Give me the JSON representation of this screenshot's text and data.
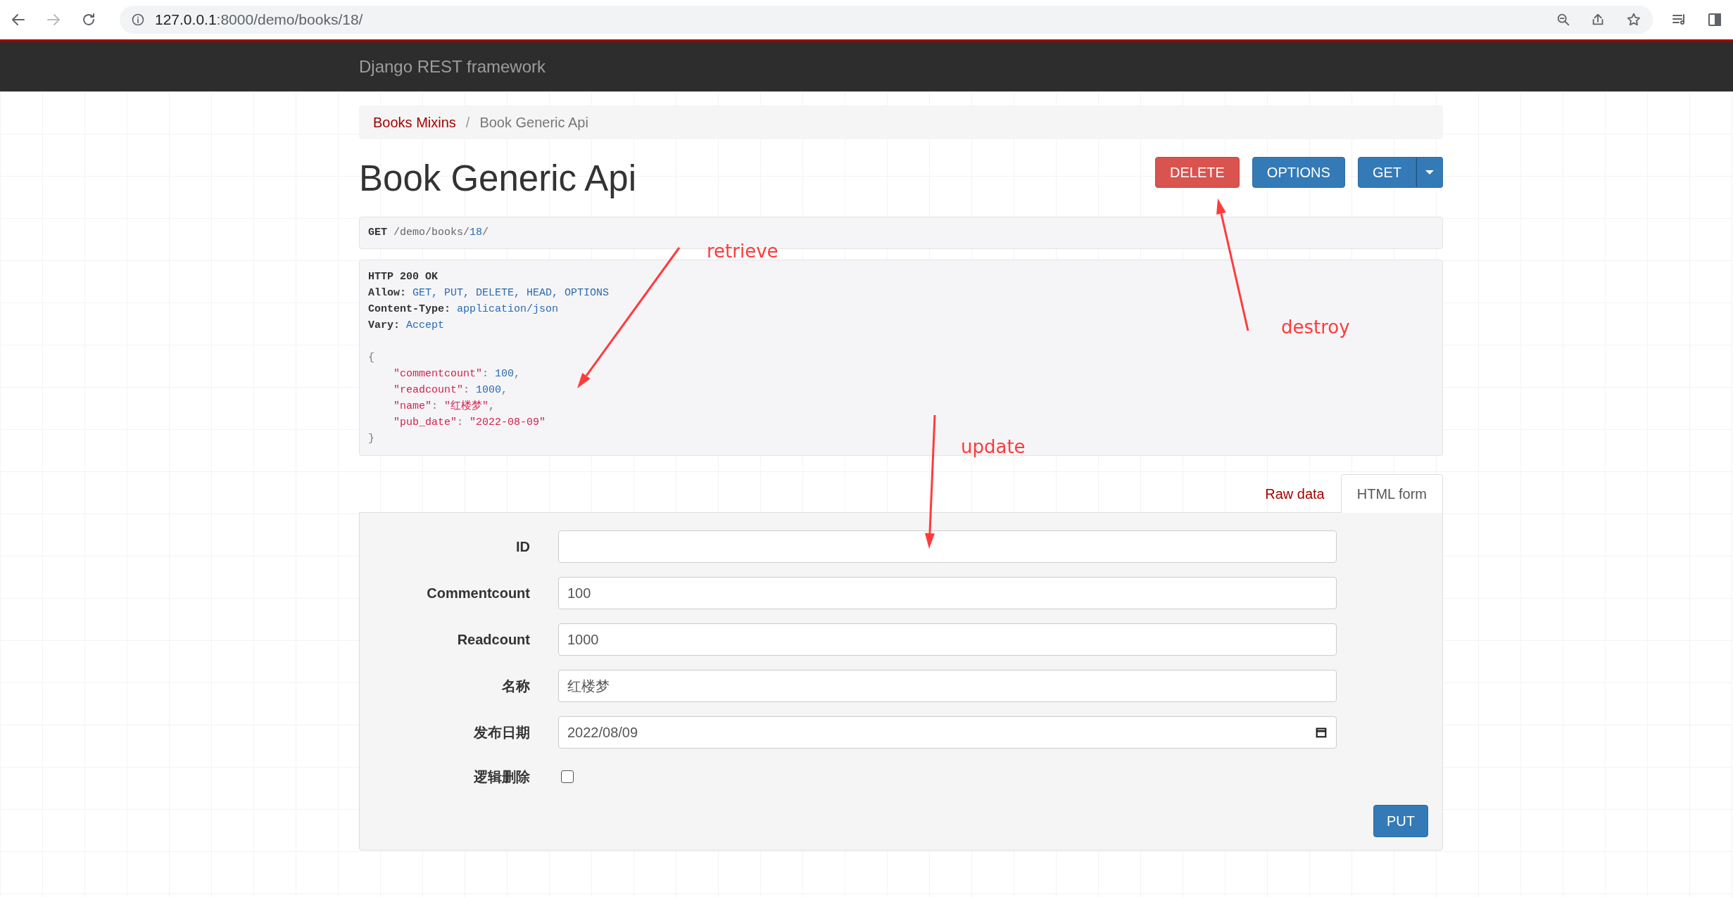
{
  "browser": {
    "url_host": "127.0.0.1",
    "url_rest": ":8000/demo/books/18/"
  },
  "navbar": {
    "brand": "Django REST framework"
  },
  "breadcrumbs": [
    {
      "label": "Books Mixins",
      "selected": false
    },
    {
      "label": "/",
      "kind": "divider"
    },
    {
      "label": "Book Generic Api",
      "selected": true
    }
  ],
  "title": "Book Generic Api",
  "actions": [
    {
      "label": "DELETE",
      "kind": "danger"
    },
    {
      "label": "OPTIONS",
      "kind": "primary"
    },
    {
      "label": "GET",
      "kind": "split"
    }
  ],
  "request": [
    {
      "text": "GET",
      "kind": "method"
    },
    {
      "text": " /demo/books/",
      "kind": "plain"
    },
    {
      "text": "18",
      "kind": "value"
    },
    {
      "text": "/",
      "kind": "plain"
    }
  ],
  "response": {
    "headers": [
      [
        {
          "text": "HTTP 200 OK",
          "kind": "name"
        }
      ],
      [
        {
          "text": "Allow:",
          "kind": "name"
        },
        {
          "text": " GET, PUT, DELETE, HEAD, OPTIONS",
          "kind": "value"
        }
      ],
      [
        {
          "text": "Content-Type:",
          "kind": "name"
        },
        {
          "text": " application/json",
          "kind": "value"
        }
      ],
      [
        {
          "text": "Vary:",
          "kind": "name"
        },
        {
          "text": " Accept",
          "kind": "value"
        }
      ]
    ],
    "body": {
      "open": [
        {
          "text": "{",
          "kind": "punct"
        }
      ],
      "fields": [
        [
          {
            "text": "\"commentcount\"",
            "kind": "string"
          },
          {
            "text": ": ",
            "kind": "punct"
          },
          {
            "text": "100",
            "kind": "number"
          },
          {
            "text": ",",
            "kind": "punct"
          }
        ],
        [
          {
            "text": "\"readcount\"",
            "kind": "string"
          },
          {
            "text": ": ",
            "kind": "punct"
          },
          {
            "text": "1000",
            "kind": "number"
          },
          {
            "text": ",",
            "kind": "punct"
          }
        ],
        [
          {
            "text": "\"name\"",
            "kind": "string"
          },
          {
            "text": ": ",
            "kind": "punct"
          },
          {
            "text": "\"红楼梦\"",
            "kind": "string"
          },
          {
            "text": ",",
            "kind": "punct"
          }
        ],
        [
          {
            "text": "\"pub_date\"",
            "kind": "string"
          },
          {
            "text": ": ",
            "kind": "punct"
          },
          {
            "text": "\"2022-08-09\"",
            "kind": "string"
          }
        ]
      ],
      "close": [
        {
          "text": "}",
          "kind": "punct"
        }
      ]
    }
  },
  "form_tabs": [
    {
      "label": "Raw data",
      "selected": false
    },
    {
      "label": "HTML form",
      "selected": true
    }
  ],
  "form": {
    "fields": [
      {
        "label": "ID",
        "kind": "text"
      },
      {
        "label": "Commentcount",
        "kind": "text",
        "value": "100"
      },
      {
        "label": "Readcount",
        "kind": "text",
        "value": "1000"
      },
      {
        "label": "名称",
        "kind": "text",
        "value": "红楼梦"
      },
      {
        "label": "发布日期",
        "kind": "date",
        "value": "2022/08/09"
      },
      {
        "label": "逻辑删除",
        "kind": "checkbox",
        "checked": false
      }
    ],
    "submit": "PUT"
  },
  "annotations": [
    {
      "text": "retrieve"
    },
    {
      "text": "destroy"
    },
    {
      "text": "update"
    }
  ]
}
